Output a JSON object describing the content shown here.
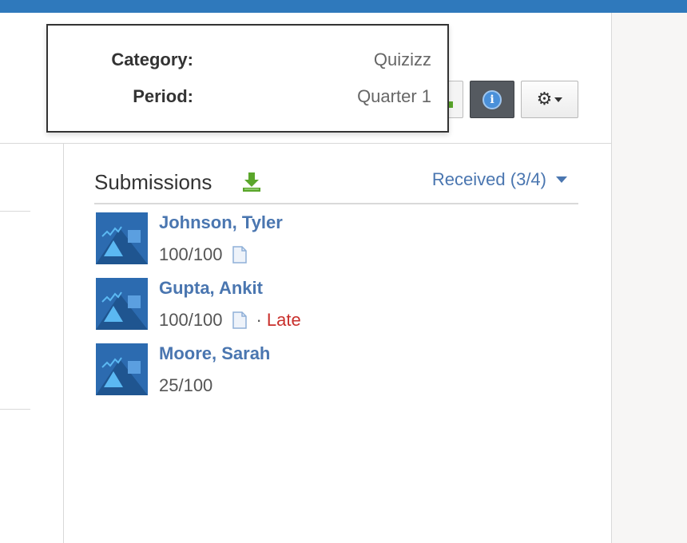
{
  "popover": {
    "rows": [
      {
        "label": "Category:",
        "value": "Quizizz"
      },
      {
        "label": "Period:",
        "value": "Quarter 1"
      }
    ]
  },
  "toolbar": {
    "info_button_icon": "info-icon",
    "settings_button_icon": "gear-icon"
  },
  "submissions": {
    "title": "Submissions",
    "filter_label": "Received (3/4)",
    "items": [
      {
        "name": "Johnson, Tyler",
        "score": "100/100",
        "has_file": true,
        "late_label": ""
      },
      {
        "name": "Gupta, Ankit",
        "score": "100/100",
        "has_file": true,
        "late_label": "Late"
      },
      {
        "name": "Moore, Sarah",
        "score": "25/100",
        "has_file": false,
        "late_label": ""
      }
    ]
  },
  "colors": {
    "top_bar": "#2f79bc",
    "link": "#4a76b0",
    "late": "#c9302c",
    "avatar_bg": "#2c6bb0"
  }
}
